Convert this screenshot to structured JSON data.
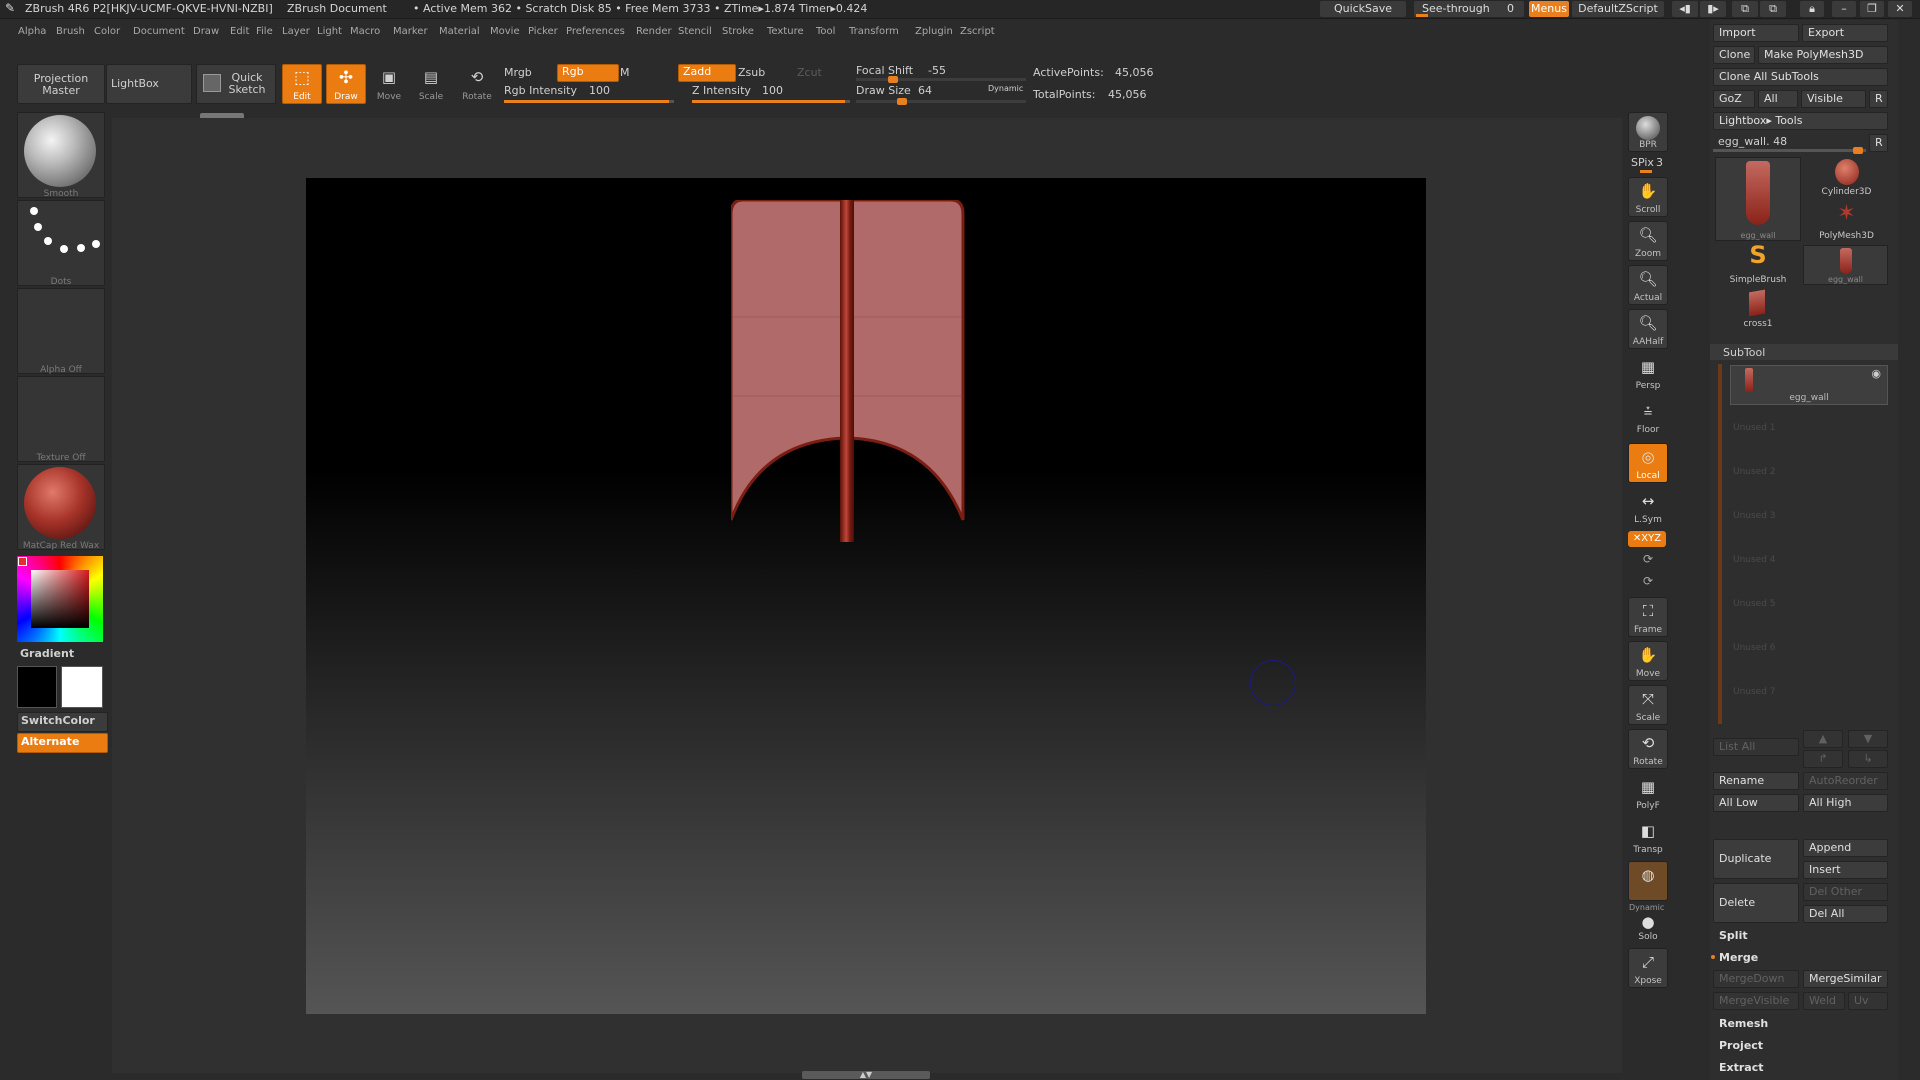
{
  "titlebar": {
    "app_title": "ZBrush 4R6 P2[HKJV-UCMF-QKVE-HVNI-NZBI]",
    "doc_title": "ZBrush Document",
    "stats": "• Active Mem 362 • Scratch Disk 85 • Free Mem 3733 • ZTime▸1.874 Timer▸0.424",
    "quicksave": "QuickSave",
    "see_through": "See-through",
    "see_through_value": "0",
    "menus": "Menus",
    "script": "DefaultZScript"
  },
  "menubar": [
    "Alpha",
    "Brush",
    "Color",
    "Document",
    "Draw",
    "Edit",
    "File",
    "Layer",
    "Light",
    "Macro",
    "Marker",
    "Material",
    "Movie",
    "Picker",
    "Preferences",
    "Render",
    "Stencil",
    "Stroke",
    "Texture",
    "Tool",
    "Transform",
    "Zplugin",
    "Zscript"
  ],
  "toolbar": {
    "projection_master": "Projection Master",
    "lightbox": "LightBox",
    "quick_sketch": "Quick Sketch",
    "edit": "Edit",
    "draw": "Draw",
    "move": "Move",
    "scale": "Scale",
    "rotate": "Rotate",
    "mrgb": "Mrgb",
    "rgb": "Rgb",
    "m": "M",
    "rgb_intensity_label": "Rgb Intensity",
    "rgb_intensity": "100",
    "zadd": "Zadd",
    "zsub": "Zsub",
    "zcut": "Zcut",
    "z_intensity_label": "Z Intensity",
    "z_intensity": "100",
    "focal_shift_label": "Focal Shift",
    "focal_shift": "-55",
    "draw_size_label": "Draw Size",
    "draw_size": "64",
    "dynamic": "Dynamic",
    "active_points_label": "ActivePoints:",
    "active_points": "45,056",
    "total_points_label": "TotalPoints:",
    "total_points": "45,056",
    "rgb_intensity_level": 0.97,
    "z_intensity_level": 0.97,
    "focal_shift_level": 0.22,
    "draw_size_level": 0.27
  },
  "left": {
    "brush": "Smooth",
    "stroke": "Dots",
    "alpha": "Alpha Off",
    "texture": "Texture Off",
    "material": "MatCap Red Wax",
    "gradient": "Gradient",
    "switchcolor": "SwitchColor",
    "alternate": "Alternate"
  },
  "shelf": {
    "bpr": "BPR",
    "spix_label": "SPix",
    "spix": "3",
    "scroll": "Scroll",
    "zoom": "Zoom",
    "actual": "Actual",
    "aahalf": "AAHalf",
    "persp": "Persp",
    "floor": "Floor",
    "local": "Local",
    "lsym": "L.Sym",
    "xyz": "✕XYZ",
    "frame": "Frame",
    "move": "Move",
    "scale": "Scale",
    "rotate": "Rotate",
    "polyf": "PolyF",
    "transp": "Transp",
    "dynamic": "Dynamic",
    "solo": "Solo",
    "xpose": "Xpose"
  },
  "tool": {
    "import": "Import",
    "export": "Export",
    "clone": "Clone",
    "make_polymesh": "Make PolyMesh3D",
    "clone_all": "Clone All SubTools",
    "goz": "GoZ",
    "all": "All",
    "visible": "Visible",
    "r": "R",
    "lightbox_tools": "Lightbox▸ Tools",
    "current_tool": "egg_wall. 48",
    "current_tool_level": 0.95,
    "thumbs": {
      "egg_wall": "egg_wall",
      "cylinder": "Cylinder3D",
      "polymesh": "PolyMesh3D",
      "simplebrush": "SimpleBrush",
      "egg_wall2": "egg_wall",
      "cross1": "cross1"
    }
  },
  "subtool": {
    "title": "SubTool",
    "active": "egg_wall",
    "unused": [
      "Unused 1",
      "Unused 2",
      "Unused 3",
      "Unused 4",
      "Unused 5",
      "Unused 6",
      "Unused 7"
    ],
    "list_all": "List All",
    "rename": "Rename",
    "autoreorder": "AutoReorder",
    "all_low": "All Low",
    "all_high": "All High",
    "duplicate": "Duplicate",
    "append": "Append",
    "insert": "Insert",
    "delete": "Delete",
    "del_other": "Del Other",
    "del_all": "Del All",
    "split": "Split",
    "merge": "Merge",
    "mergedown": "MergeDown",
    "mergesimilar": "MergeSimilar",
    "mergevisible": "MergeVisible",
    "weld": "Weld",
    "uv": "Uv",
    "remesh": "Remesh",
    "project": "Project",
    "extract": "Extract"
  },
  "colors": {
    "accent": "#ea7c12",
    "model": "#b06a6a",
    "model_edge": "#7a1d12"
  }
}
